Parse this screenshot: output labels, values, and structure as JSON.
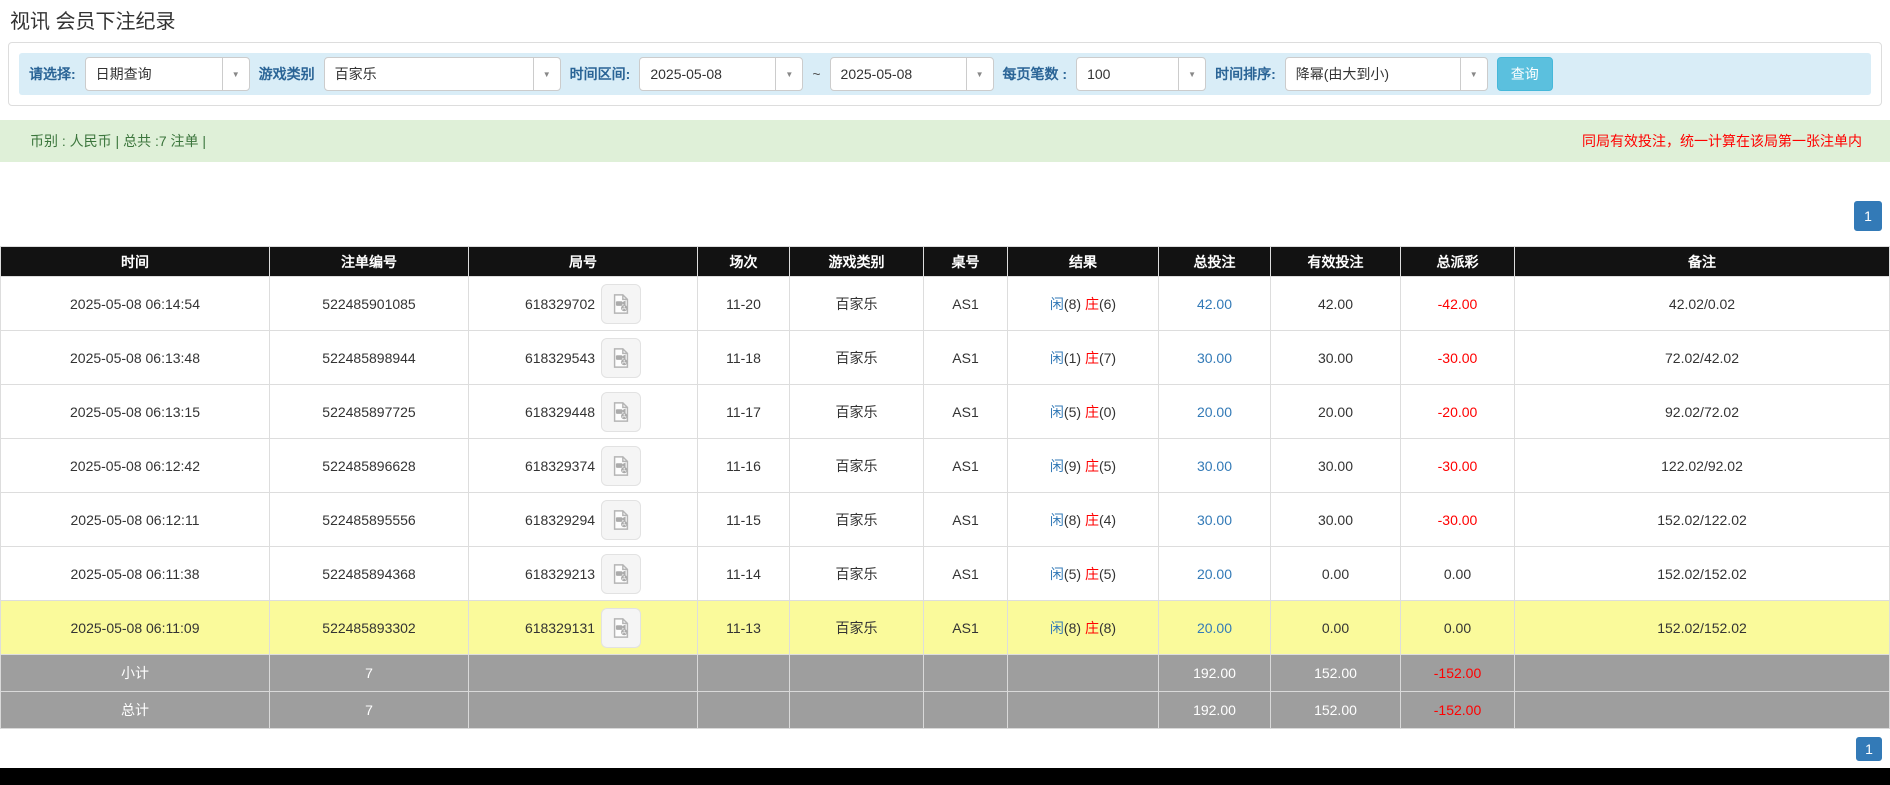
{
  "page_title": "视讯 会员下注纪录",
  "filters": {
    "select_label": "请选择:",
    "select_value": "日期查询",
    "game_type_label": "游戏类别",
    "game_type_value": "百家乐",
    "time_range_label": "时间区间:",
    "date_from": "2025-05-08",
    "range_separator": "~",
    "date_to": "2025-05-08",
    "per_page_label": "每页笔数 :",
    "per_page_value": "100",
    "sort_label": "时间排序:",
    "sort_value": "降幂(由大到小)",
    "search_button": "查询"
  },
  "summary_bar": {
    "left_text": "币别 : 人民币 | 总共 :7 注单 |",
    "right_note": "同局有效投注，统一计算在该局第一张注单内"
  },
  "pagination": {
    "page": "1"
  },
  "colors": {
    "accent_blue": "#337ab7",
    "player_blue": "#337ab7",
    "banker_red": "#ff0000",
    "negative_red": "#ff0000",
    "highlight_yellow": "#fafa9b",
    "summary_gray": "#9e9e9e",
    "notice_green_bg": "#dff0d8",
    "filter_bar_bg": "#d9edf7",
    "button_cyan": "#5bc0de"
  },
  "table": {
    "headers": [
      "时间",
      "注单编号",
      "局号",
      "场次",
      "游戏类别",
      "桌号",
      "结果",
      "总投注",
      "有效投注",
      "总派彩",
      "备注"
    ],
    "video_icon": "video-file-icon",
    "rows": [
      {
        "time": "2025-05-08 06:14:54",
        "bet_id": "522485901085",
        "round_id": "618329702",
        "session": "11-20",
        "game": "百家乐",
        "table_no": "AS1",
        "result": {
          "player_label": "闲",
          "player_score": "(8)",
          "banker_label": "庄",
          "banker_score": "(6)"
        },
        "total_bet": "42.00",
        "valid_bet": "42.00",
        "payout": "-42.00",
        "remark": "42.02/0.02",
        "highlight": false
      },
      {
        "time": "2025-05-08 06:13:48",
        "bet_id": "522485898944",
        "round_id": "618329543",
        "session": "11-18",
        "game": "百家乐",
        "table_no": "AS1",
        "result": {
          "player_label": "闲",
          "player_score": "(1)",
          "banker_label": "庄",
          "banker_score": "(7)"
        },
        "total_bet": "30.00",
        "valid_bet": "30.00",
        "payout": "-30.00",
        "remark": "72.02/42.02",
        "highlight": false
      },
      {
        "time": "2025-05-08 06:13:15",
        "bet_id": "522485897725",
        "round_id": "618329448",
        "session": "11-17",
        "game": "百家乐",
        "table_no": "AS1",
        "result": {
          "player_label": "闲",
          "player_score": "(5)",
          "banker_label": "庄",
          "banker_score": "(0)"
        },
        "total_bet": "20.00",
        "valid_bet": "20.00",
        "payout": "-20.00",
        "remark": "92.02/72.02",
        "highlight": false
      },
      {
        "time": "2025-05-08 06:12:42",
        "bet_id": "522485896628",
        "round_id": "618329374",
        "session": "11-16",
        "game": "百家乐",
        "table_no": "AS1",
        "result": {
          "player_label": "闲",
          "player_score": "(9)",
          "banker_label": "庄",
          "banker_score": "(5)"
        },
        "total_bet": "30.00",
        "valid_bet": "30.00",
        "payout": "-30.00",
        "remark": "122.02/92.02",
        "highlight": false
      },
      {
        "time": "2025-05-08 06:12:11",
        "bet_id": "522485895556",
        "round_id": "618329294",
        "session": "11-15",
        "game": "百家乐",
        "table_no": "AS1",
        "result": {
          "player_label": "闲",
          "player_score": "(8)",
          "banker_label": "庄",
          "banker_score": "(4)"
        },
        "total_bet": "30.00",
        "valid_bet": "30.00",
        "payout": "-30.00",
        "remark": "152.02/122.02",
        "highlight": false
      },
      {
        "time": "2025-05-08 06:11:38",
        "bet_id": "522485894368",
        "round_id": "618329213",
        "session": "11-14",
        "game": "百家乐",
        "table_no": "AS1",
        "result": {
          "player_label": "闲",
          "player_score": "(5)",
          "banker_label": "庄",
          "banker_score": "(5)"
        },
        "total_bet": "20.00",
        "valid_bet": "0.00",
        "payout": "0.00",
        "remark": "152.02/152.02",
        "highlight": false
      },
      {
        "time": "2025-05-08 06:11:09",
        "bet_id": "522485893302",
        "round_id": "618329131",
        "session": "11-13",
        "game": "百家乐",
        "table_no": "AS1",
        "result": {
          "player_label": "闲",
          "player_score": "(8)",
          "banker_label": "庄",
          "banker_score": "(8)"
        },
        "total_bet": "20.00",
        "valid_bet": "0.00",
        "payout": "0.00",
        "remark": "152.02/152.02",
        "highlight": true
      }
    ],
    "subtotal": {
      "label": "小计",
      "count": "7",
      "total_bet": "192.00",
      "valid_bet": "152.00",
      "payout": "-152.00"
    },
    "total": {
      "label": "总计",
      "count": "7",
      "total_bet": "192.00",
      "valid_bet": "152.00",
      "payout": "-152.00"
    }
  }
}
